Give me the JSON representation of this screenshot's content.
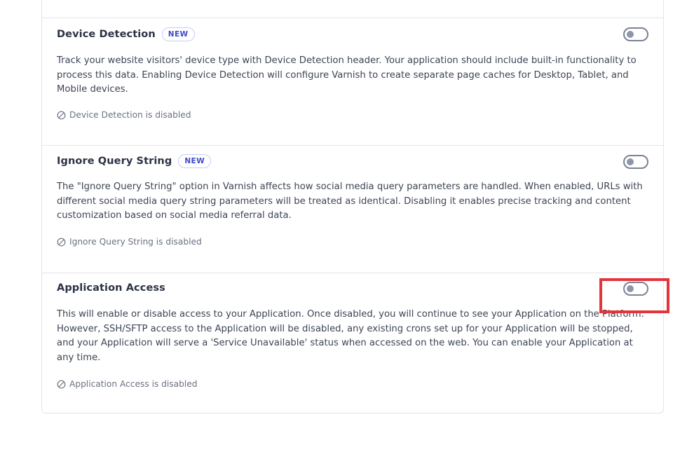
{
  "sections": [
    {
      "title": "Device Detection",
      "badge": "NEW",
      "enabled": false,
      "description": "Track your website visitors' device type with Device Detection header. Your application should include built-in functionality to process this data. Enabling Device Detection will configure Varnish to create separate page caches for Desktop, Tablet, and Mobile devices.",
      "status": "Device Detection is disabled",
      "status_icon": "disabled-icon"
    },
    {
      "title": "Ignore Query String",
      "badge": "NEW",
      "enabled": false,
      "description": "The \"Ignore Query String\" option in Varnish affects how social media query parameters are handled. When enabled, URLs with different social media query string parameters will be treated as identical. Disabling it enables precise tracking and content customization based on social media referral data.",
      "status": "Ignore Query String is disabled",
      "status_icon": "disabled-icon"
    },
    {
      "title": "Application Access",
      "enabled": false,
      "description": "This will enable or disable access to your Application. Once disabled, you will continue to see your Application on the Platform. However, SSH/SFTP access to the Application will be disabled, any existing crons set up for your Application will be stopped, and your Application will serve a 'Service Unavailable' status when accessed on the web. You can enable your Application at any time.",
      "status": "Application Access is disabled",
      "status_icon": "disabled-icon"
    }
  ],
  "colors": {
    "badge_text": "#3f49c9",
    "badge_border": "#c9cdf5",
    "toggle_border": "#7b8294",
    "highlight": "#e5333a"
  }
}
